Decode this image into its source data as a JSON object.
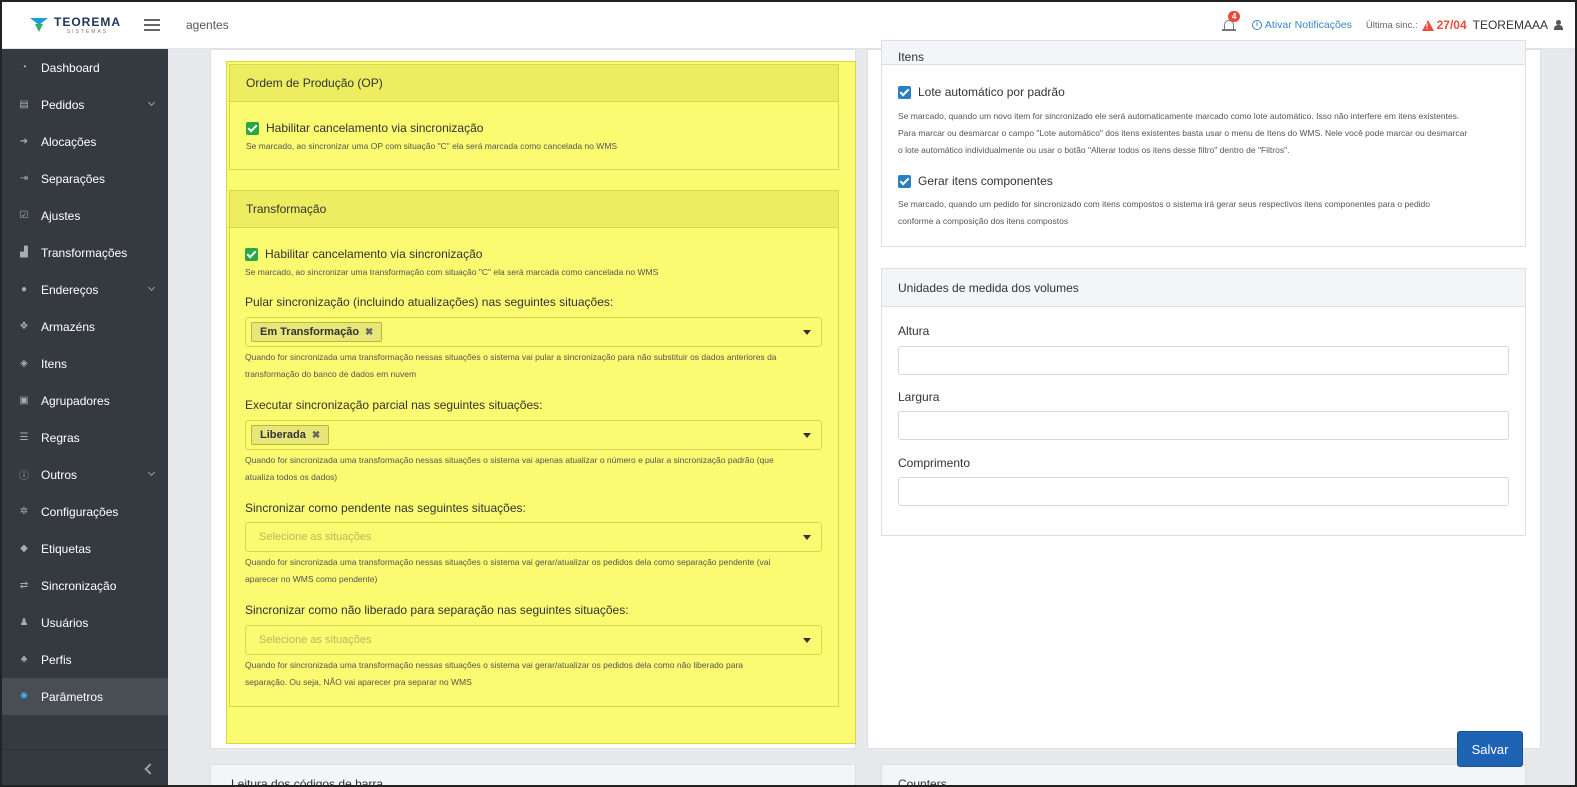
{
  "header": {
    "brand": "TEOREMA",
    "brand_sub": "SISTEMAS",
    "section": "agentes",
    "notification_count": "4",
    "notifications_link": "Ativar Notificações",
    "last_sync_label": "Última sinc.:",
    "last_sync_date": "27/04",
    "user": "TEOREMAAA"
  },
  "sidebar": {
    "items": [
      {
        "label": "Dashboard",
        "icon": "dashboard-icon"
      },
      {
        "label": "Pedidos",
        "icon": "list-icon"
      },
      {
        "label": "Alocações",
        "icon": "sign-in-icon"
      },
      {
        "label": "Separações",
        "icon": "sign-out-icon"
      },
      {
        "label": "Ajustes",
        "icon": "check-square-icon"
      },
      {
        "label": "Transformações",
        "icon": "bar-chart-icon"
      },
      {
        "label": "Endereços",
        "icon": "map-marker-icon"
      },
      {
        "label": "Armazéns",
        "icon": "cubes-icon"
      },
      {
        "label": "Itens",
        "icon": "cube-icon"
      },
      {
        "label": "Agrupadores",
        "icon": "object-group-icon"
      },
      {
        "label": "Regras",
        "icon": "list-ul-icon"
      },
      {
        "label": "Outros",
        "icon": "info-icon"
      },
      {
        "label": "Configurações",
        "icon": "gear-icon"
      },
      {
        "label": "Etiquetas",
        "icon": "tags-icon"
      },
      {
        "label": "Sincronização",
        "icon": "exchange-icon"
      },
      {
        "label": "Usuários",
        "icon": "user-icon"
      },
      {
        "label": "Perfis",
        "icon": "users-icon"
      },
      {
        "label": "Parâmetros",
        "icon": "cog-icon"
      }
    ]
  },
  "op_section": {
    "title": "Ordem de Produção (OP)",
    "checkbox_label": "Habilitar cancelamento via sincronização",
    "help": "Se marcado, ao sincronizar uma OP com situação \"C\" ela será marcada como cancelada no WMS"
  },
  "transform_section": {
    "title": "Transformação",
    "checkbox_label": "Habilitar cancelamento via sincronização",
    "checkbox_help": "Se marcado, ao sincronizar uma transformação com situação \"C\" ela será marcada como cancelada no WMS",
    "skip_label": "Pular sincronização (incluindo atualizações) nas seguintes situações:",
    "skip_tag": "Em Transformação",
    "skip_help_1": "Quando for sincronizada uma transformação nessas situações o sistema vai pular a sincronização para não substituir os dados anteriores da",
    "skip_help_2": "transformação do banco de dados em nuvem",
    "partial_label": "Executar sincronização parcial nas seguintes situações:",
    "partial_tag": "Liberada",
    "partial_help_1": "Quando for sincronizada uma transformação nessas situações o sistema vai apenas atualizar o número e pular a sincronização padrão (que",
    "partial_help_2": "atualiza todos os dados)",
    "pending_label": "Sincronizar como pendente nas seguintes situações:",
    "pending_placeholder": "Selecione as situações",
    "pending_help_1": "Quando for sincronizada uma transformação nessas situações o sistema vai gerar/atualizar os pedidos dela como separação pendente (vai",
    "pending_help_2": "aparecer no WMS como pendente)",
    "notreleased_label": "Sincronizar como não liberado para separação nas seguintes situações:",
    "notreleased_placeholder": "Selecione as situações",
    "notreleased_help_1": "Quando for sincronizada uma transformação nessas situações o sistema vai gerar/atualizar os pedidos dela como não liberado para",
    "notreleased_help_2": "separação. Ou seja, NÃO vai aparecer pra separar no WMS"
  },
  "items_section": {
    "title": "Itens",
    "lote_label": "Lote automático por padrão",
    "lote_help_1": "Se marcado, quando um novo item for sincronizado ele será automaticamente marcado como lote automático. Isso não interfere em itens existentes.",
    "lote_help_2": "Para marcar ou desmarcar o campo \"Lote automático\" dos itens existentes basta usar o menu de Itens do WMS. Nele você pode marcar ou desmarcar",
    "lote_help_3": "o lote automático individualmente ou usar o botão \"Alterar todos os itens desse filtro\" dentro de \"Filtros\".",
    "comp_label": "Gerar itens componentes",
    "comp_help_1": "Se marcado, quando um pedido for sincronizado com itens compostos o sistema irá gerar seus respectivos itens componentes para o pedido",
    "comp_help_2": "conforme a composição dos itens compostos"
  },
  "units_section": {
    "title": "Unidades de medida dos volumes",
    "height_label": "Altura",
    "width_label": "Largura",
    "length_label": "Comprimento",
    "height_value": "",
    "width_value": "",
    "length_value": ""
  },
  "bottom": {
    "barcode_title": "Leitura dos códigos de barra",
    "counters_title": "Counters"
  },
  "actions": {
    "save": "Salvar"
  }
}
